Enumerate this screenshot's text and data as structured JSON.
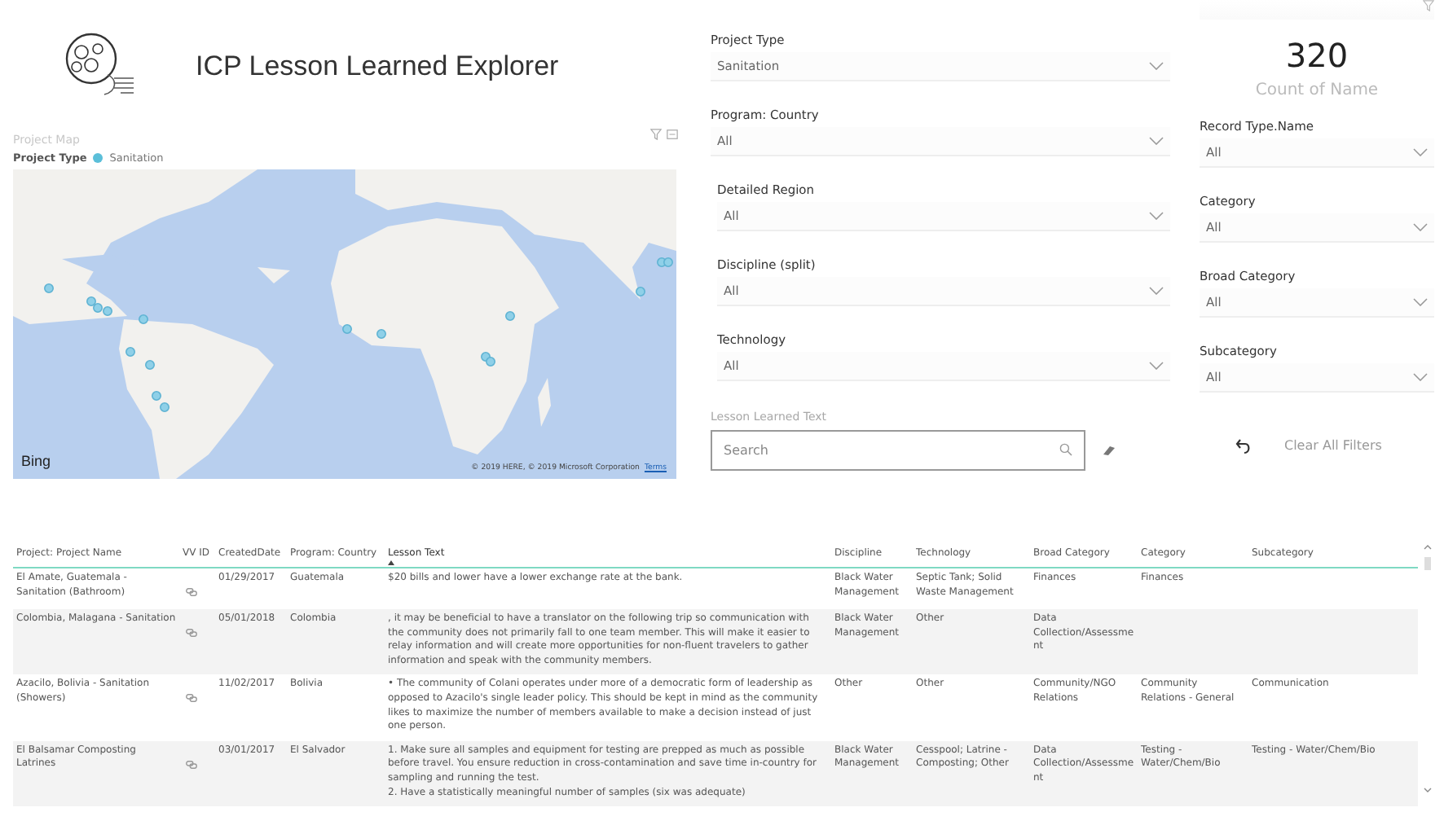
{
  "header": {
    "title": "ICP Lesson Learned Explorer"
  },
  "map": {
    "title": "Project Map",
    "legend": {
      "label": "Project Type",
      "items": [
        {
          "label": "Sanitation",
          "color": "#5bbfd9"
        }
      ]
    },
    "provider": "Bing",
    "attribution": "© 2019 HERE, © 2019 Microsoft Corporation",
    "terms": "Terms"
  },
  "filters_left": [
    {
      "label": "Project Type",
      "value": "Sanitation"
    },
    {
      "label": "Program: Country",
      "value": "All"
    },
    {
      "label": "Detailed Region",
      "value": "All"
    },
    {
      "label": "Discipline (split)",
      "value": "All"
    },
    {
      "label": "Technology",
      "value": "All"
    }
  ],
  "search": {
    "label": "Lesson Learned Text",
    "placeholder": "Search"
  },
  "kpi": {
    "value": "320",
    "label": "Count of Name"
  },
  "filters_right": [
    {
      "label": "Record Type.Name",
      "value": "All"
    },
    {
      "label": "Category",
      "value": "All"
    },
    {
      "label": "Broad Category",
      "value": "All"
    },
    {
      "label": "Subcategory",
      "value": "All"
    }
  ],
  "clear_button": "Clear All Filters",
  "table": {
    "columns": [
      {
        "label": "Project: Project Name",
        "sorted": false
      },
      {
        "label": "VV ID",
        "sorted": false
      },
      {
        "label": "CreatedDate",
        "sorted": false
      },
      {
        "label": "Program: Country",
        "sorted": false
      },
      {
        "label": "Lesson Text",
        "sorted": true
      },
      {
        "label": "Discipline",
        "sorted": false
      },
      {
        "label": "Technology",
        "sorted": false
      },
      {
        "label": "Broad Category",
        "sorted": false
      },
      {
        "label": "Category",
        "sorted": false
      },
      {
        "label": "Subcategory",
        "sorted": false
      }
    ],
    "rows": [
      [
        "El Amate, Guatemala - Sanitation (Bathroom)",
        "",
        "01/29/2017",
        "Guatemala",
        "$20 bills and lower have a lower exchange rate at the bank.",
        "Black Water Management",
        "Septic Tank; Solid Waste Management",
        "Finances",
        "Finances",
        ""
      ],
      [
        "Colombia, Malagana - Sanitation",
        "",
        "05/01/2018",
        "Colombia",
        ", it may be beneficial to have a translator on the following trip so communication with the community does not primarily fall to one team member. This will make it easier to relay information and will create more opportunities for non-fluent travelers to gather information and speak with the community members.",
        "Black Water Management",
        "Other",
        "Data Collection/Assessment",
        "",
        ""
      ],
      [
        "Azacilo, Bolivia - Sanitation (Showers)",
        "",
        "11/02/2017",
        "Bolivia",
        "• The community of Colani operates under more of a democratic form of leadership as opposed to Azacilo's single leader policy. This should be kept in mind as the community likes to maximize the number of members available to make a decision instead of just one person.",
        "Other",
        "Other",
        "Community/NGO Relations",
        "Community Relations - General",
        "Communication"
      ],
      [
        "El Balsamar Composting Latrines",
        "",
        "03/01/2017",
        "El Salvador",
        "1. Make sure all samples and equipment for testing are prepped as much as possible before travel. You ensure reduction in cross-contamination and save time in-country for sampling and running the test.\n2. Have a statistically meaningful number of samples (six was adequate)",
        "Black Water Management",
        "Cesspool; Latrine - Composting; Other",
        "Data Collection/Assessment",
        "Testing - Water/Chem/Bio",
        "Testing - Water/Chem/Bio"
      ]
    ]
  }
}
